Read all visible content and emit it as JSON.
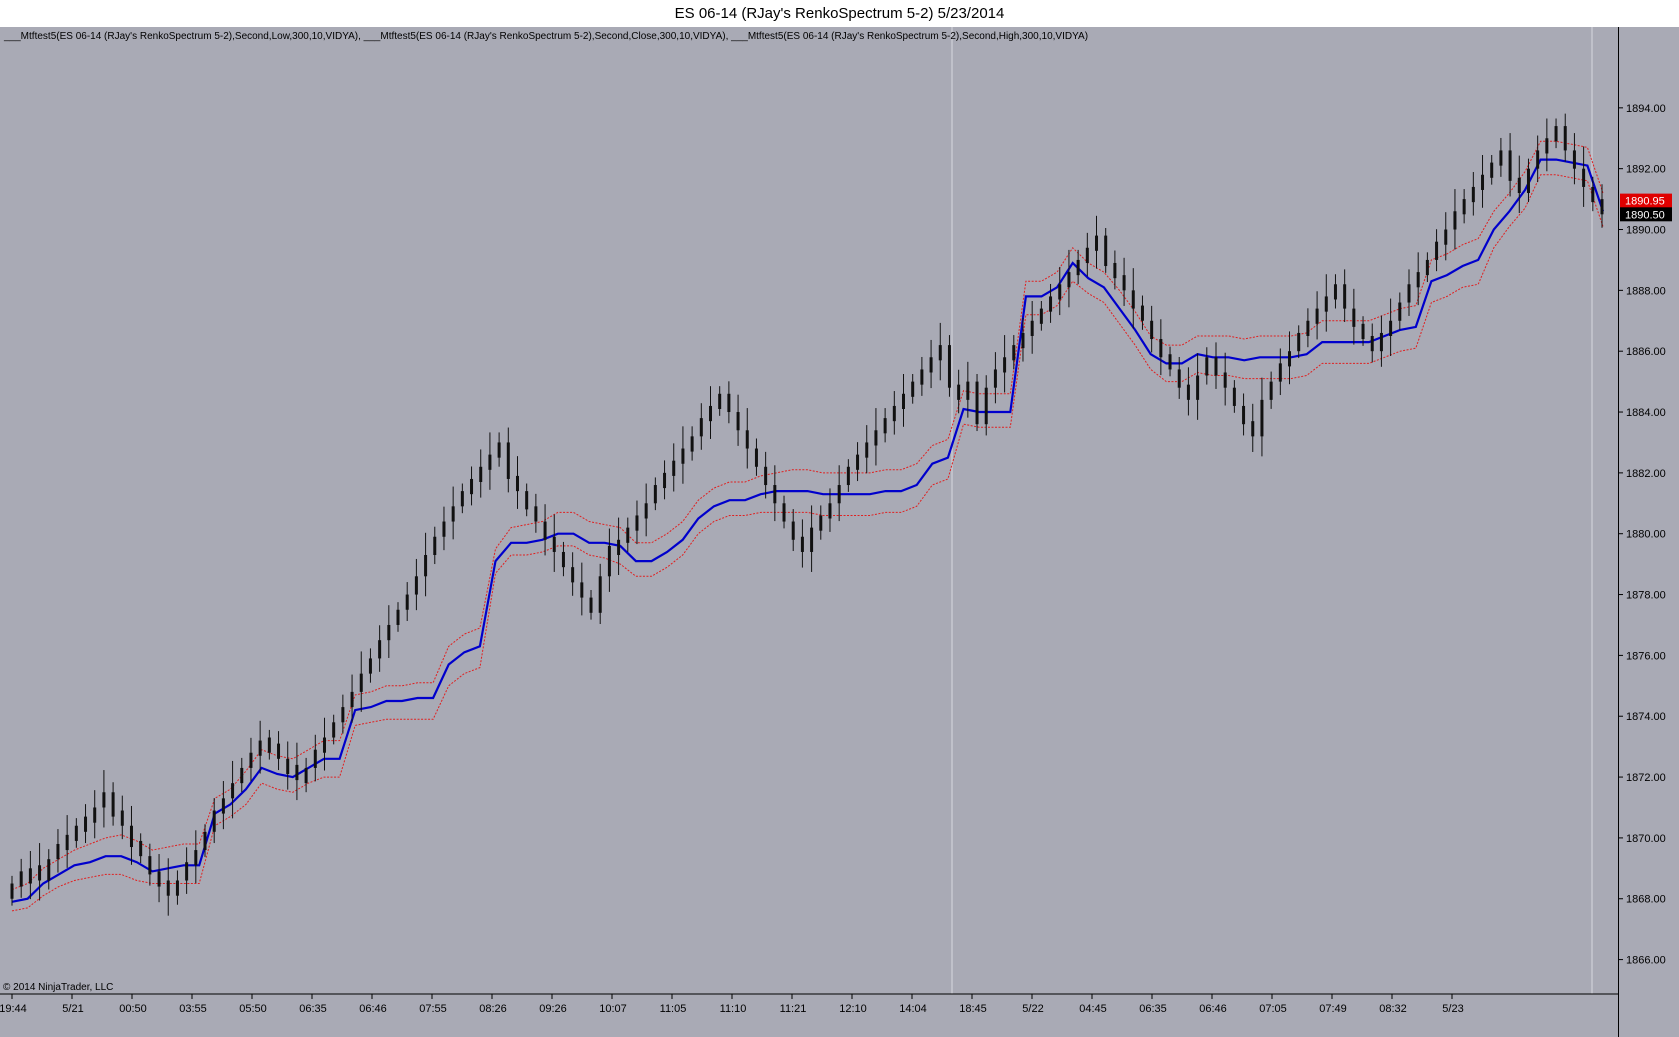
{
  "window": {
    "title": "ES 06-14 (RJay's RenkoSpectrum 5-2)  5/23/2014"
  },
  "indicator_legend": "___Mtftest5(ES 06-14 (RJay's RenkoSpectrum 5-2),Second,Low,300,10,VIDYA), ___Mtftest5(ES 06-14 (RJay's RenkoSpectrum 5-2),Second,Close,300,10,VIDYA), ___Mtftest5(ES 06-14 (RJay's RenkoSpectrum 5-2),Second,High,300,10,VIDYA)",
  "copyright": "© 2014 NinjaTrader, LLC",
  "colors": {
    "background": "#a9aab5",
    "candle": "#111111",
    "vidya_close": "#0000cc",
    "vidya_band": "#e02020",
    "last_price_badge": "#e00000",
    "current_price_badge": "#000000"
  },
  "price_badges": {
    "last": "1890.95",
    "current": "1890.50"
  },
  "chart_data": {
    "type": "candlestick",
    "ylim": [
      1865,
      1896
    ],
    "y_ticks": [
      "1894.00",
      "1892.00",
      "1890.00",
      "1888.00",
      "1886.00",
      "1884.00",
      "1882.00",
      "1880.00",
      "1878.00",
      "1876.00",
      "1874.00",
      "1872.00",
      "1870.00",
      "1868.00",
      "1866.00"
    ],
    "x_tick_labels": [
      "19:44",
      "5/21",
      "00:50",
      "03:55",
      "05:50",
      "06:35",
      "06:46",
      "07:55",
      "08:26",
      "09:26",
      "10:07",
      "11:05",
      "11:10",
      "11:21",
      "12:10",
      "14:04",
      "18:45",
      "5/22",
      "04:45",
      "06:35",
      "06:46",
      "07:05",
      "07:49",
      "08:32",
      "5/23"
    ],
    "close": [
      1868.5,
      1868.9,
      1869.0,
      1868.6,
      1869.3,
      1869.8,
      1870.1,
      1870.4,
      1870.7,
      1871.0,
      1871.5,
      1870.7,
      1870.4,
      1869.7,
      1869.4,
      1868.8,
      1868.4,
      1868.1,
      1868.6,
      1869.2,
      1869.6,
      1870.2,
      1870.9,
      1871.3,
      1871.8,
      1872.3,
      1872.8,
      1873.2,
      1872.8,
      1872.6,
      1872.1,
      1871.9,
      1872.3,
      1872.9,
      1873.3,
      1873.8,
      1874.3,
      1874.8,
      1875.4,
      1875.9,
      1876.5,
      1877.0,
      1877.5,
      1878.0,
      1878.6,
      1879.3,
      1879.9,
      1880.4,
      1880.9,
      1881.4,
      1881.8,
      1882.2,
      1882.6,
      1883.0,
      1881.8,
      1881.4,
      1880.8,
      1880.4,
      1879.8,
      1879.4,
      1878.9,
      1878.4,
      1877.9,
      1877.4,
      1878.6,
      1879.6,
      1879.8,
      1880.2,
      1880.6,
      1881.0,
      1881.6,
      1882.0,
      1882.4,
      1882.8,
      1883.2,
      1883.8,
      1884.2,
      1884.6,
      1884.0,
      1883.4,
      1882.8,
      1882.2,
      1881.6,
      1881.0,
      1880.4,
      1879.8,
      1879.4,
      1880.2,
      1880.6,
      1881.0,
      1881.6,
      1882.2,
      1882.6,
      1883.0,
      1883.4,
      1883.8,
      1884.2,
      1884.6,
      1885.0,
      1885.4,
      1885.8,
      1886.2,
      1884.8,
      1884.4,
      1885.0,
      1883.6,
      1884.8,
      1885.4,
      1885.8,
      1886.2,
      1886.6,
      1887.0,
      1887.4,
      1887.8,
      1888.2,
      1888.6,
      1889.0,
      1889.4,
      1889.8,
      1888.8,
      1888.4,
      1888.0,
      1887.4,
      1887.0,
      1886.4,
      1885.8,
      1885.4,
      1884.8,
      1884.4,
      1885.2,
      1885.8,
      1885.2,
      1884.8,
      1884.2,
      1883.6,
      1883.2,
      1884.4,
      1885.0,
      1885.6,
      1886.0,
      1886.6,
      1887.0,
      1887.4,
      1887.8,
      1888.2,
      1887.4,
      1886.8,
      1886.4,
      1886.0,
      1886.6,
      1887.0,
      1887.6,
      1888.2,
      1888.6,
      1889.0,
      1889.6,
      1890.0,
      1890.6,
      1891.0,
      1891.4,
      1891.8,
      1892.2,
      1892.6,
      1891.6,
      1891.2,
      1892.0,
      1892.6,
      1893.0,
      1893.4,
      1892.6,
      1892.0,
      1891.4,
      1890.9,
      1890.5
    ],
    "vidya_close": [
      1867.9,
      1868.0,
      1868.5,
      1868.8,
      1869.1,
      1869.2,
      1869.4,
      1869.4,
      1869.2,
      1868.9,
      1869.0,
      1869.1,
      1869.1,
      1870.8,
      1871.1,
      1871.6,
      1872.3,
      1872.1,
      1872.0,
      1872.3,
      1872.6,
      1872.6,
      1874.2,
      1874.3,
      1874.5,
      1874.5,
      1874.6,
      1874.6,
      1875.7,
      1876.1,
      1876.3,
      1879.1,
      1879.7,
      1879.7,
      1879.8,
      1880.0,
      1880.0,
      1879.7,
      1879.7,
      1879.6,
      1879.1,
      1879.1,
      1879.4,
      1879.8,
      1880.5,
      1880.9,
      1881.1,
      1881.1,
      1881.3,
      1881.4,
      1881.4,
      1881.4,
      1881.3,
      1881.3,
      1881.3,
      1881.3,
      1881.4,
      1881.4,
      1881.6,
      1882.3,
      1882.5,
      1884.1,
      1884.0,
      1884.0,
      1884.0,
      1887.8,
      1887.8,
      1888.1,
      1888.9,
      1888.4,
      1888.1,
      1887.4,
      1886.7,
      1885.9,
      1885.6,
      1885.6,
      1885.9,
      1885.8,
      1885.8,
      1885.7,
      1885.8,
      1885.8,
      1885.8,
      1885.9,
      1886.3,
      1886.3,
      1886.3,
      1886.3,
      1886.5,
      1886.7,
      1886.8,
      1888.3,
      1888.5,
      1888.8,
      1889.0,
      1890.0,
      1890.6,
      1891.3,
      1892.3,
      1892.3,
      1892.2,
      1892.1,
      1890.6
    ],
    "vidya_high": [
      1868.3,
      1868.5,
      1869.0,
      1869.3,
      1869.6,
      1869.8,
      1870.0,
      1870.1,
      1869.9,
      1869.6,
      1869.7,
      1869.8,
      1869.8,
      1871.3,
      1871.6,
      1872.2,
      1872.9,
      1872.7,
      1872.6,
      1872.9,
      1873.2,
      1873.2,
      1874.7,
      1874.8,
      1875.0,
      1875.0,
      1875.1,
      1875.1,
      1876.3,
      1876.7,
      1876.9,
      1879.5,
      1880.2,
      1880.3,
      1880.4,
      1880.7,
      1880.7,
      1880.4,
      1880.3,
      1880.2,
      1879.7,
      1879.7,
      1880.0,
      1880.4,
      1881.1,
      1881.5,
      1881.7,
      1881.7,
      1881.9,
      1882.0,
      1882.1,
      1882.1,
      1882.0,
      1882.0,
      1882.0,
      1882.0,
      1882.1,
      1882.1,
      1882.3,
      1882.9,
      1883.1,
      1884.7,
      1884.6,
      1884.6,
      1884.6,
      1888.3,
      1888.3,
      1888.6,
      1889.4,
      1888.9,
      1888.6,
      1888.0,
      1887.3,
      1886.5,
      1886.2,
      1886.2,
      1886.5,
      1886.5,
      1886.5,
      1886.4,
      1886.5,
      1886.5,
      1886.5,
      1886.6,
      1887.0,
      1887.0,
      1887.0,
      1887.0,
      1887.2,
      1887.4,
      1887.5,
      1889.0,
      1889.2,
      1889.5,
      1889.7,
      1890.6,
      1891.2,
      1891.9,
      1892.9,
      1892.9,
      1892.8,
      1892.7,
      1891.2
    ],
    "vidya_low": [
      1867.6,
      1867.7,
      1868.1,
      1868.4,
      1868.6,
      1868.7,
      1868.8,
      1868.8,
      1868.6,
      1868.5,
      1868.5,
      1868.5,
      1868.5,
      1870.4,
      1870.7,
      1871.1,
      1871.8,
      1871.6,
      1871.5,
      1871.8,
      1872.0,
      1872.0,
      1873.7,
      1873.8,
      1873.9,
      1873.9,
      1873.9,
      1873.9,
      1875.0,
      1875.4,
      1875.6,
      1878.7,
      1879.3,
      1879.3,
      1879.4,
      1879.6,
      1879.6,
      1879.3,
      1879.2,
      1879.0,
      1878.6,
      1878.6,
      1878.9,
      1879.3,
      1880.0,
      1880.4,
      1880.6,
      1880.6,
      1880.7,
      1880.7,
      1880.7,
      1880.7,
      1880.6,
      1880.6,
      1880.6,
      1880.6,
      1880.7,
      1880.7,
      1880.9,
      1881.6,
      1881.8,
      1883.6,
      1883.5,
      1883.5,
      1883.5,
      1887.2,
      1887.2,
      1887.5,
      1888.3,
      1887.9,
      1887.6,
      1886.9,
      1886.2,
      1885.4,
      1885.0,
      1885.0,
      1885.3,
      1885.2,
      1885.2,
      1885.1,
      1885.1,
      1885.1,
      1885.1,
      1885.2,
      1885.6,
      1885.6,
      1885.6,
      1885.6,
      1885.8,
      1886.0,
      1886.1,
      1887.6,
      1887.8,
      1888.1,
      1888.2,
      1889.4,
      1890.1,
      1890.7,
      1891.8,
      1891.8,
      1891.7,
      1891.6,
      1890.1
    ]
  }
}
